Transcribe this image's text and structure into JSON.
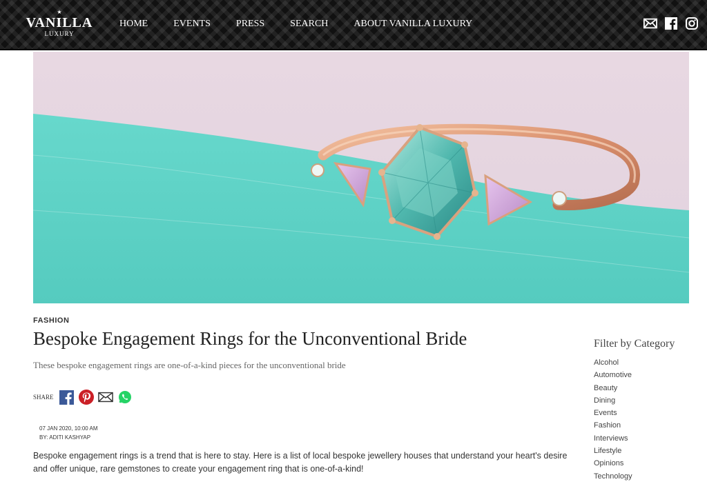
{
  "header": {
    "logo": {
      "brand": "VANILLA",
      "sub": "LUXURY",
      "star": "★"
    },
    "nav": [
      "HOME",
      "EVENTS",
      "PRESS",
      "SEARCH",
      "ABOUT VANILLA LUXURY"
    ],
    "social": [
      "mail-icon",
      "facebook-icon",
      "instagram-icon"
    ]
  },
  "article": {
    "category": "FASHION",
    "title": "Bespoke Engagement Rings for the Unconventional Bride",
    "subtitle": "These bespoke engagement rings are one-of-a-kind pieces for the unconventional bride",
    "share_label": "SHARE",
    "share_icons": [
      "facebook-icon",
      "pinterest-icon",
      "email-icon",
      "whatsapp-icon"
    ],
    "date": "07 JAN 2020, 10:00 AM",
    "byline": "BY: ADITI KASHYAP",
    "body": "Bespoke engagement rings is a trend that is here to stay. Here is a list of local bespoke jewellery houses that understand your heart's desire and offer unique, rare gemstones to create your engagement ring that is one-of-a-kind!"
  },
  "sidebar": {
    "filter_title": "Filter by Category",
    "categories": [
      "Alcohol",
      "Automotive",
      "Beauty",
      "Dining",
      "Events",
      "Fashion",
      "Interviews",
      "Lifestyle",
      "Opinions",
      "Technology"
    ]
  },
  "colors": {
    "header_bg": "#111111",
    "facebook": "#3b5998",
    "pinterest": "#cb2027",
    "whatsapp": "#25d366",
    "teal": "#5fd3c8"
  }
}
